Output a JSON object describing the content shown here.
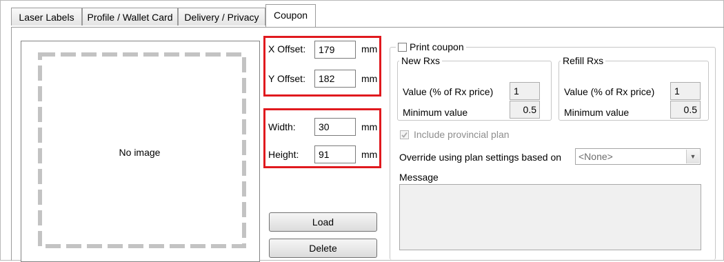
{
  "tabs": [
    {
      "label": "Laser Labels"
    },
    {
      "label": "Profile / Wallet Card"
    },
    {
      "label": "Delivery / Privacy"
    },
    {
      "label": "Coupon"
    }
  ],
  "image_box": {
    "placeholder_text": "No image"
  },
  "offset": {
    "x_label": "X Offset:",
    "x_value": "179",
    "x_unit": "mm",
    "y_label": "Y Offset:",
    "y_value": "182",
    "y_unit": "mm"
  },
  "size": {
    "width_label": "Width:",
    "width_value": "30",
    "width_unit": "mm",
    "height_label": "Height:",
    "height_value": "91",
    "height_unit": "mm"
  },
  "buttons": {
    "load": "Load",
    "delete": "Delete"
  },
  "coupon": {
    "print_label": "Print coupon",
    "new_rxs": {
      "title": "New Rxs",
      "value_label": "Value (% of Rx price)",
      "value": "1",
      "min_label": "Minimum value",
      "min_value": "0.5"
    },
    "refill_rxs": {
      "title": "Refill Rxs",
      "value_label": "Value (% of Rx price)",
      "value": "1",
      "min_label": "Minimum value",
      "min_value": "0.5"
    },
    "include_provincial_label": "Include provincial plan",
    "override_label": "Override using plan settings based on",
    "override_selected": "<None>",
    "message_label": "Message",
    "message_value": ""
  },
  "colors": {
    "highlight": "#e0191e"
  }
}
